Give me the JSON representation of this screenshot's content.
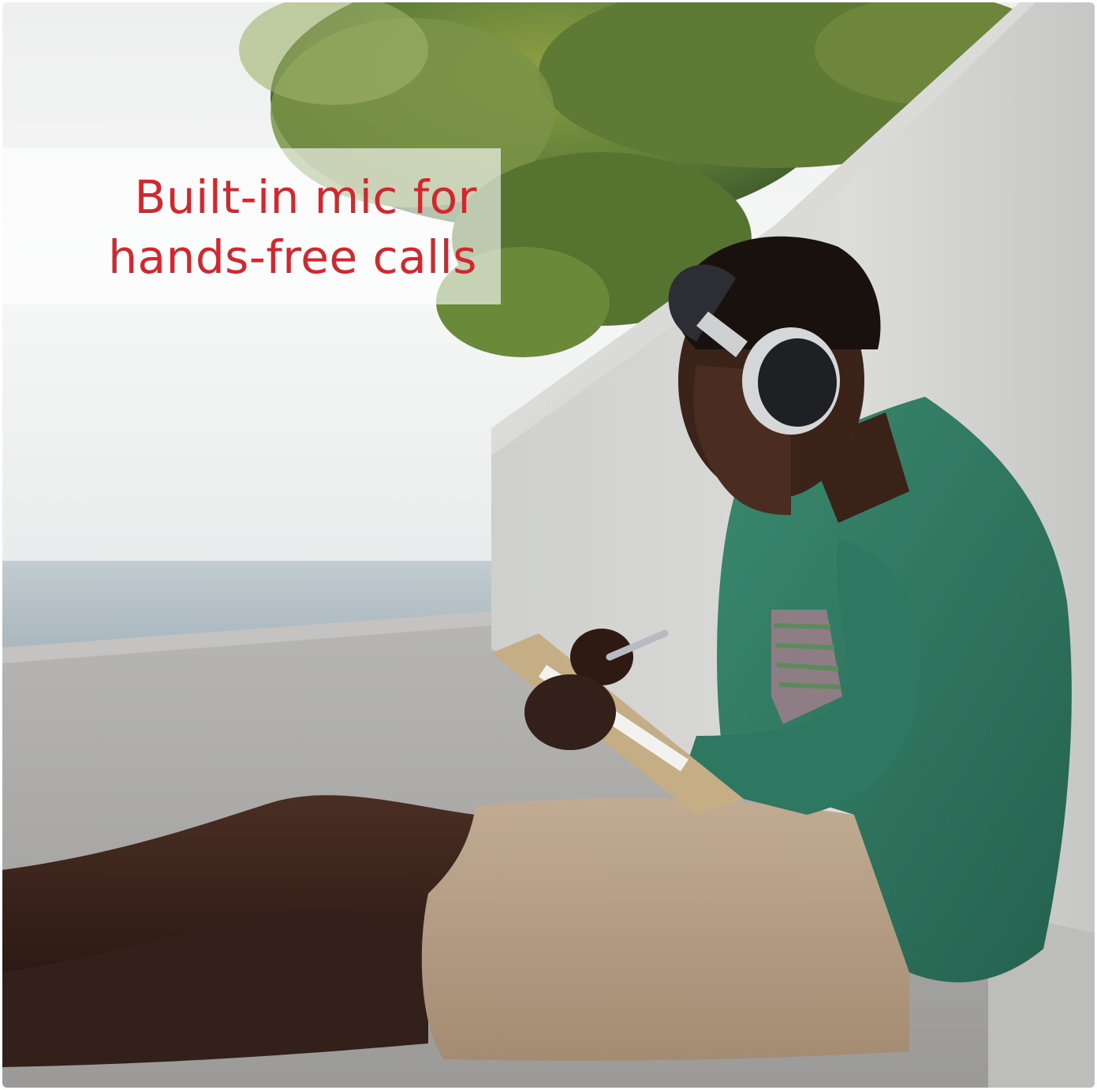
{
  "caption": {
    "line1": "Built-in mic for",
    "line2": "hands-free calls"
  },
  "colors": {
    "caption_text": "#d4262c",
    "sky": "#f3f5f5",
    "sea": "#b9c6cc",
    "wall": "#d8d8d4",
    "shirt": "#2f7a62",
    "shorts": "#b59d84",
    "skin": "#3b241c",
    "headphones": "#2b2d31"
  },
  "scene": {
    "description_icon": "photo-icon"
  }
}
